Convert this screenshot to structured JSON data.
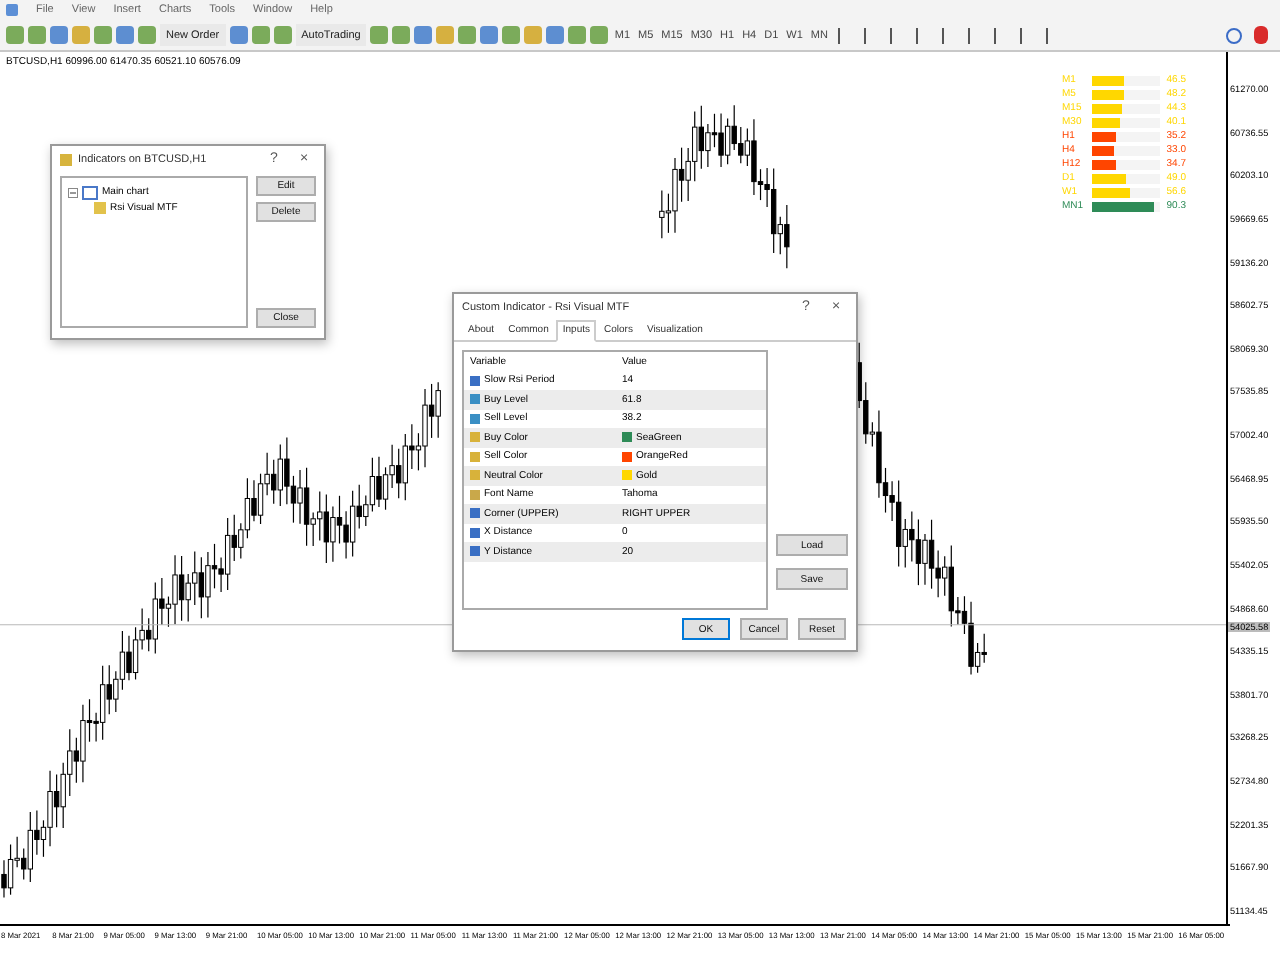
{
  "menu": [
    "File",
    "View",
    "Insert",
    "Charts",
    "Tools",
    "Window",
    "Help"
  ],
  "toolbar": {
    "new_order": "New Order",
    "auto_trading": "AutoTrading",
    "timeframes": [
      "M1",
      "M5",
      "M15",
      "M30",
      "H1",
      "H4",
      "D1",
      "W1",
      "MN"
    ]
  },
  "chart": {
    "info": "BTCUSD,H1  60996.00 61470.35 60521.10 60576.09",
    "price_labels": [
      "61270.00",
      "60736.55",
      "60203.10",
      "59669.65",
      "59136.20",
      "58602.75",
      "58069.30",
      "57535.85",
      "57002.40",
      "56468.95",
      "55935.50",
      "55402.05",
      "54868.60",
      "54335.15",
      "53801.70",
      "53268.25",
      "52734.80",
      "52201.35",
      "51667.90",
      "51134.45"
    ],
    "current_price": "54025.58",
    "time_labels": [
      "8 Mar 2021",
      "8 Mar 21:00",
      "9 Mar 05:00",
      "9 Mar 13:00",
      "9 Mar 21:00",
      "10 Mar 05:00",
      "10 Mar 13:00",
      "10 Mar 21:00",
      "11 Mar 05:00",
      "11 Mar 13:00",
      "11 Mar 21:00",
      "12 Mar 05:00",
      "12 Mar 13:00",
      "12 Mar 21:00",
      "13 Mar 05:00",
      "13 Mar 13:00",
      "13 Mar 21:00",
      "14 Mar 05:00",
      "14 Mar 13:00",
      "14 Mar 21:00",
      "15 Mar 05:00",
      "15 Mar 13:00",
      "15 Mar 21:00",
      "16 Mar 05:00"
    ]
  },
  "rsi_panel": [
    {
      "timeframe": "M1",
      "value": "46.5",
      "level": 0.46,
      "color": "#ffd700"
    },
    {
      "timeframe": "M5",
      "value": "48.2",
      "level": 0.48,
      "color": "#ffd700"
    },
    {
      "timeframe": "M15",
      "value": "44.3",
      "level": 0.44,
      "color": "#ffd700"
    },
    {
      "timeframe": "M30",
      "value": "40.1",
      "level": 0.4,
      "color": "#ffd700"
    },
    {
      "timeframe": "H1",
      "value": "35.2",
      "level": 0.35,
      "color": "#ff4500"
    },
    {
      "timeframe": "H4",
      "value": "33.0",
      "level": 0.33,
      "color": "#ff4500"
    },
    {
      "timeframe": "H12",
      "value": "34.7",
      "level": 0.35,
      "color": "#ff4500"
    },
    {
      "timeframe": "D1",
      "value": "49.0",
      "level": 0.49,
      "color": "#ffd700"
    },
    {
      "timeframe": "W1",
      "value": "56.6",
      "level": 0.57,
      "color": "#ffd700"
    },
    {
      "timeframe": "MN1",
      "value": "90.3",
      "level": 0.9,
      "color": "#2e8b57"
    }
  ],
  "indicators_dialog": {
    "title": "Indicators on BTCUSD,H1",
    "help": "?",
    "close": "×",
    "tree": [
      {
        "label": "Main chart",
        "expanded": true,
        "children": [
          {
            "label": "Rsi Visual MTF"
          }
        ]
      }
    ],
    "buttons": [
      "Edit",
      "Delete",
      "Close"
    ]
  },
  "custom_dialog": {
    "title": "Custom Indicator - Rsi Visual MTF",
    "help": "?",
    "close": "×",
    "tabs": [
      {
        "label": "About",
        "selected": false
      },
      {
        "label": "Common",
        "selected": false
      },
      {
        "label": "Inputs",
        "selected": true
      },
      {
        "label": "Colors",
        "selected": false
      },
      {
        "label": "Visualization",
        "selected": false
      }
    ],
    "columns": [
      "Variable",
      "Value"
    ],
    "rows": [
      {
        "kind": "int",
        "variable": "Slow Rsi Period",
        "value": "14"
      },
      {
        "kind": "double",
        "variable": "Buy Level",
        "value": "61.8"
      },
      {
        "kind": "double",
        "variable": "Sell Level",
        "value": "38.2"
      },
      {
        "kind": "color",
        "variable": "Buy Color",
        "value": "SeaGreen",
        "color": "#2e8b57"
      },
      {
        "kind": "color",
        "variable": "Sell Color",
        "value": "OrangeRed",
        "color": "#ff4500"
      },
      {
        "kind": "color",
        "variable": "Neutral Color",
        "value": "Gold",
        "color": "#ffd700"
      },
      {
        "kind": "string",
        "variable": "Font Name",
        "value": "Tahoma"
      },
      {
        "kind": "enum",
        "variable": "Corner (UPPER)",
        "value": "RIGHT UPPER"
      },
      {
        "kind": "int",
        "variable": "X Distance",
        "value": "0"
      },
      {
        "kind": "int",
        "variable": "Y Distance",
        "value": "20"
      }
    ],
    "side_buttons": [
      "Load",
      "Save"
    ],
    "buttons": [
      "OK",
      "Cancel",
      "Reset"
    ]
  }
}
